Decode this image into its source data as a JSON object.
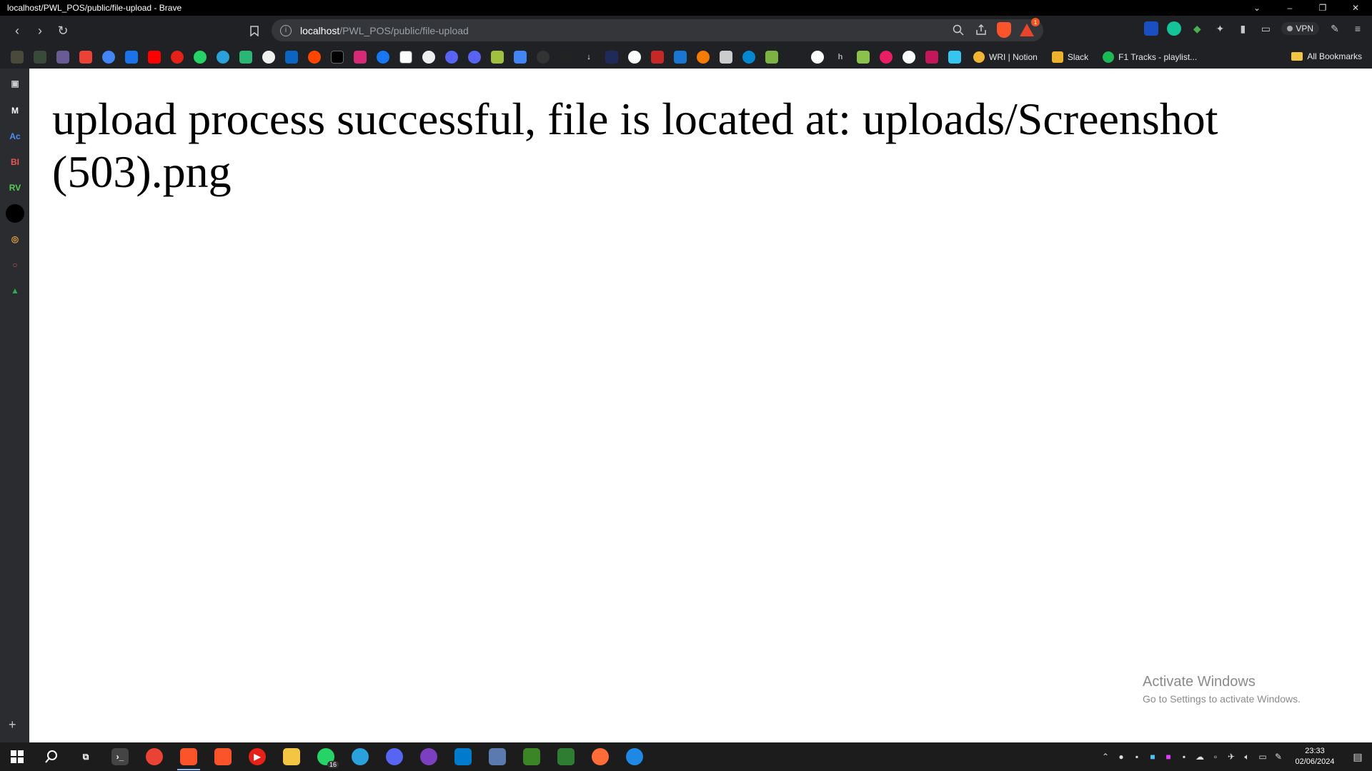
{
  "window": {
    "title": "localhost/PWL_POS/public/file-upload - Brave",
    "minimize": "–",
    "restore": "❐",
    "close": "✕",
    "menu_chevron": "⌄"
  },
  "toolbar": {
    "back": "‹",
    "forward": "›",
    "reload": "↻",
    "bookmark_icon": "bookmark-icon",
    "url_host": "localhost",
    "url_path": "/PWL_POS/public/file-upload",
    "rewards_badge": "1",
    "vpn_label": "VPN"
  },
  "bookmarks": {
    "items": [
      {
        "label": "WRI | Notion",
        "color": "#f2b634"
      },
      {
        "label": "Slack",
        "color": "#4a154b"
      },
      {
        "label": "F1 Tracks - playlist...",
        "color": "#1db954"
      }
    ],
    "all_label": "All Bookmarks"
  },
  "sidebar": {
    "items": [
      "M",
      "Ac",
      "BI",
      "RV"
    ],
    "add": "+"
  },
  "page": {
    "message": "upload process successful, file is located at: uploads/Screenshot (503).png"
  },
  "watermark": {
    "title": "Activate Windows",
    "subtitle": "Go to Settings to activate Windows."
  },
  "taskbar": {
    "whatsapp_badge": "16",
    "time": "23:33",
    "date": "02/06/2024"
  }
}
